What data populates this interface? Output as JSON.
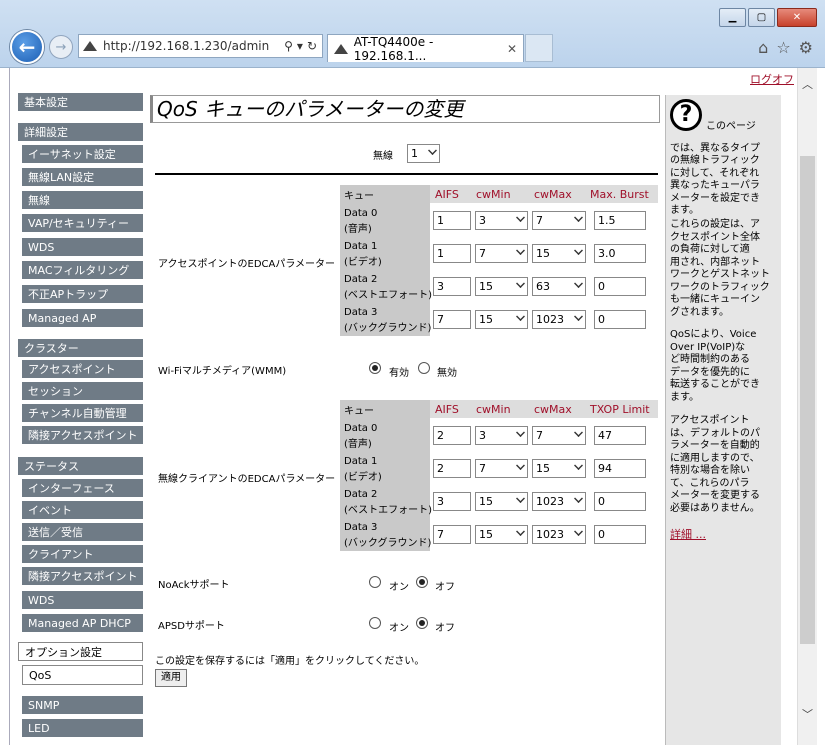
{
  "browser": {
    "url": "http://192.168.1.230/admin",
    "tab_title": "AT-TQ4400e - 192.168.1...",
    "back": "←",
    "forward": "→"
  },
  "header": {
    "logout": "ログオフ"
  },
  "sidebar": {
    "groups": [
      {
        "label": "基本設定",
        "items": []
      },
      {
        "label": "詳細設定",
        "items": [
          "イーサネット設定",
          "無線LAN設定",
          "無線",
          "VAP/セキュリティー",
          "WDS",
          "MACフィルタリング",
          "不正APトラップ",
          "Managed AP"
        ]
      },
      {
        "label": "クラスター",
        "items": [
          "アクセスポイント",
          "セッション",
          "チャンネル自動管理",
          "隣接アクセスポイント"
        ]
      },
      {
        "label": "ステータス",
        "items": [
          "インターフェース",
          "イベント",
          "送信／受信",
          "クライアント",
          "隣接アクセスポイント",
          "WDS",
          "Managed AP DHCP"
        ]
      },
      {
        "label": "オプション設定",
        "items": [
          "QoS"
        ]
      },
      {
        "label": "",
        "items": [
          "SNMP",
          "LED"
        ]
      }
    ]
  },
  "main": {
    "title": "QoS キューのパラメーターの変更",
    "radio_label": "無線",
    "radio_value": "1",
    "ap_edca": {
      "label": "アクセスポイントのEDCAパラメーター",
      "headers": [
        "キュー",
        "AIFS",
        "cwMin",
        "cwMax",
        "Max. Burst"
      ],
      "rows": [
        {
          "name": "Data 0",
          "sub": "(音声)",
          "aifs": "1",
          "cwmin": "3",
          "cwmax": "7",
          "burst": "1.5"
        },
        {
          "name": "Data 1",
          "sub": "(ビデオ)",
          "aifs": "1",
          "cwmin": "7",
          "cwmax": "15",
          "burst": "3.0"
        },
        {
          "name": "Data 2",
          "sub": "(ベストエフォート)",
          "aifs": "3",
          "cwmin": "15",
          "cwmax": "63",
          "burst": "0"
        },
        {
          "name": "Data 3",
          "sub": "(バックグラウンド)",
          "aifs": "7",
          "cwmin": "15",
          "cwmax": "1023",
          "burst": "0"
        }
      ]
    },
    "wmm": {
      "label": "Wi-Fiマルチメディア(WMM)",
      "on": "有効",
      "off": "無効",
      "value": "on"
    },
    "client_edca": {
      "label": "無線クライアントのEDCAパラメーター",
      "headers": [
        "キュー",
        "AIFS",
        "cwMin",
        "cwMax",
        "TXOP Limit"
      ],
      "rows": [
        {
          "name": "Data 0",
          "sub": "(音声)",
          "aifs": "2",
          "cwmin": "3",
          "cwmax": "7",
          "burst": "47"
        },
        {
          "name": "Data 1",
          "sub": "(ビデオ)",
          "aifs": "2",
          "cwmin": "7",
          "cwmax": "15",
          "burst": "94"
        },
        {
          "name": "Data 2",
          "sub": "(ベストエフォート)",
          "aifs": "3",
          "cwmin": "15",
          "cwmax": "1023",
          "burst": "0"
        },
        {
          "name": "Data 3",
          "sub": "(バックグラウンド)",
          "aifs": "7",
          "cwmin": "15",
          "cwmax": "1023",
          "burst": "0"
        }
      ]
    },
    "noack": {
      "label": "NoAckサポート",
      "on": "オン",
      "off": "オフ",
      "value": "off"
    },
    "apsd": {
      "label": "APSDサポート",
      "on": "オン",
      "off": "オフ",
      "value": "off"
    },
    "save_note": "この設定を保存するには「適用」をクリックしてください。",
    "apply": "適用"
  },
  "help": {
    "lines1": [
      "このページ",
      "では、異なるタイプ",
      "の無線トラフィック",
      "に対して、それぞれ",
      "異なったキューパラ",
      "メーターを設定でき",
      "ます。"
    ],
    "lines2": [
      "これらの設定は、ア",
      "クセスポイント全体",
      "の負荷に対して適",
      "用され、内部ネット",
      "ワークとゲストネット",
      "ワークのトラフィック",
      "も一緒にキューイン",
      "グされます。"
    ],
    "lines3": [
      "QoSにより、Voice",
      "Over IP(VoIP)な",
      "ど時間制約のある",
      "データを優先的に",
      "転送することができ",
      "ます。"
    ],
    "lines4": [
      "アクセスポイント",
      "は、デフォルトのパ",
      "ラメーターを自動的",
      "に適用しますので、",
      "特別な場合を除い",
      "て、これらのパラ",
      "メーターを変更する",
      "必要はありません。"
    ],
    "more": "詳細 ..."
  }
}
